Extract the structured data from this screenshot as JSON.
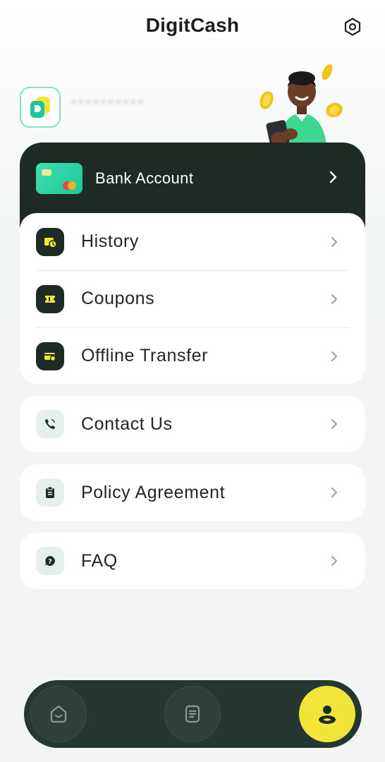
{
  "header": {
    "title": "DigitCash",
    "settings_icon": "settings-hexagon-icon"
  },
  "profile": {
    "avatar_icon": "app-logo-icon",
    "username": "**********"
  },
  "bank": {
    "label": "Bank Account",
    "icon": "bank-card-icon"
  },
  "menu": {
    "main": [
      {
        "label": "History",
        "icon": "history-wallet-icon"
      },
      {
        "label": "Coupons",
        "icon": "coupon-ticket-icon"
      },
      {
        "label": "Offline Transfer",
        "icon": "offline-transfer-icon"
      }
    ],
    "contact": {
      "label": "Contact Us",
      "icon": "phone-icon"
    },
    "policy": {
      "label": "Policy Agreement",
      "icon": "clipboard-icon"
    },
    "faq": {
      "label": "FAQ",
      "icon": "question-bubble-icon"
    }
  },
  "nav": [
    {
      "name": "home",
      "icon": "home-smile-icon",
      "active": false
    },
    {
      "name": "orders",
      "icon": "document-list-icon",
      "active": false
    },
    {
      "name": "profile",
      "icon": "profile-user-icon",
      "active": true
    }
  ],
  "colors": {
    "dark": "#1e2a24",
    "accent_green": "#1cc79a",
    "accent_yellow": "#f2e53a",
    "nav_bg": "#263630"
  }
}
